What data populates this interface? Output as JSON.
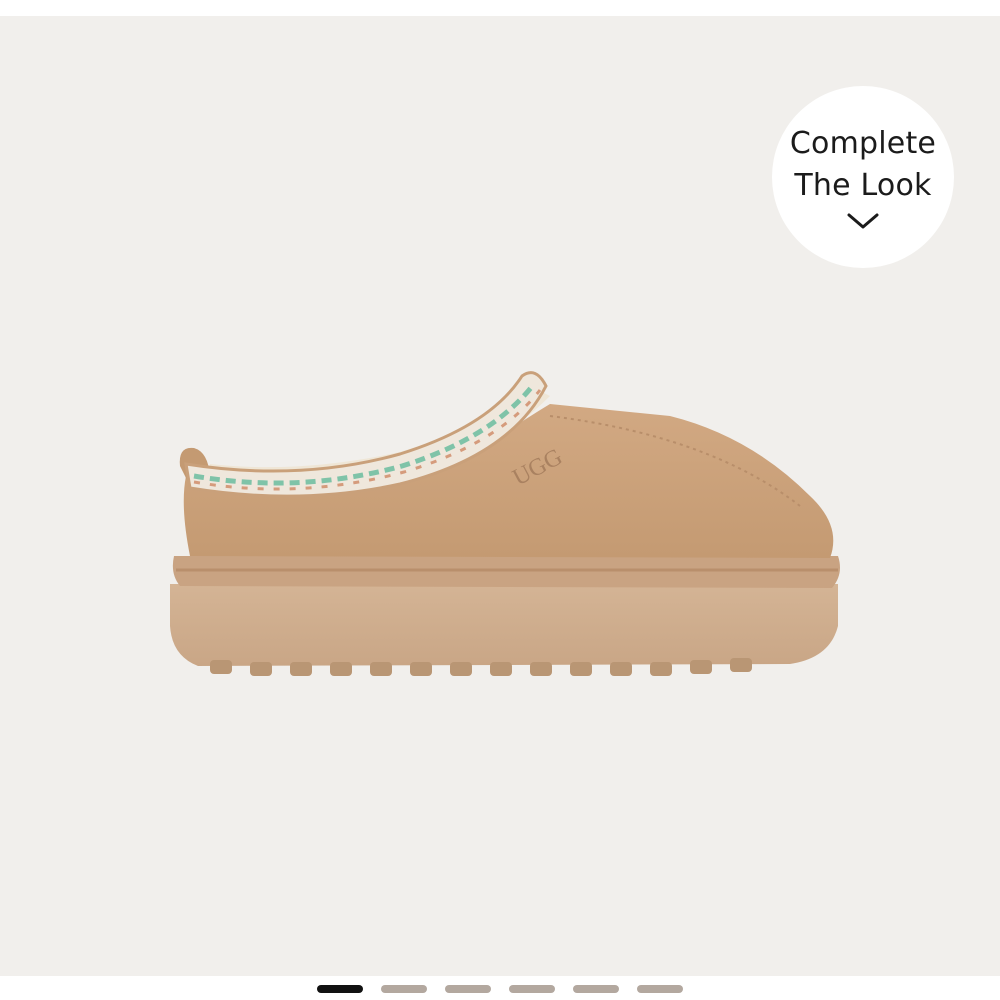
{
  "gallery": {
    "background": "#f1efec",
    "image_alt": "UGG Tazz platform slipper in chestnut suede with braided collar",
    "logo_text": "UGG"
  },
  "complete_the_look": {
    "line1": "Complete",
    "line2": "The Look",
    "icon": "chevron-down-icon"
  },
  "pagination": {
    "total": 6,
    "active_index": 0,
    "active_color": "#111111",
    "inactive_color": "#b3a89f"
  },
  "colors": {
    "suede": "#caa17c",
    "sole": "#cfae8c",
    "braid_green": "#7fc3a8"
  }
}
